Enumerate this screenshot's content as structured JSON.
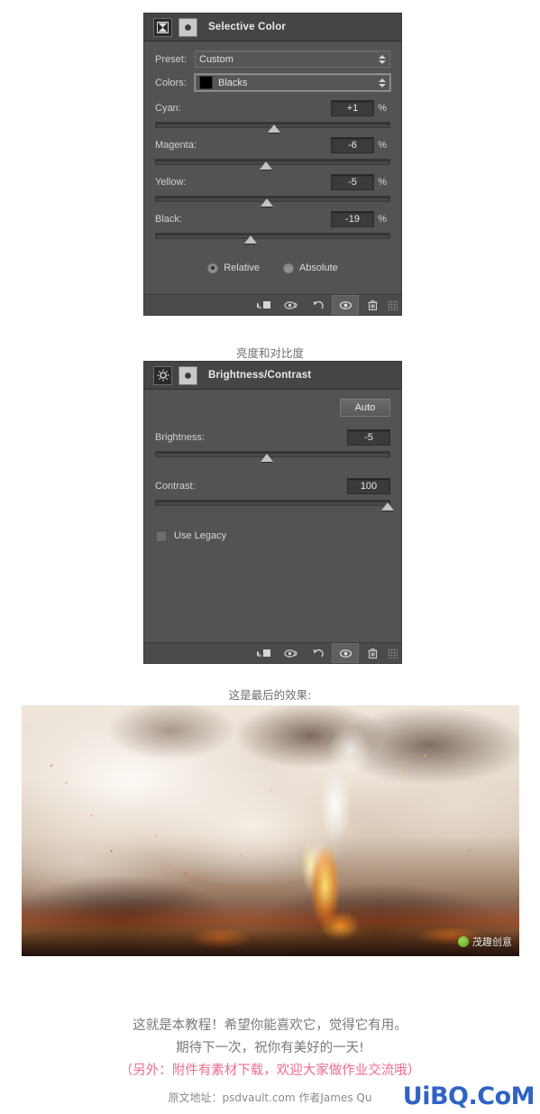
{
  "selective_color": {
    "title": "Selective Color",
    "icon": "selective-color-icon",
    "preset_label": "Preset:",
    "preset_value": "Custom",
    "colors_label": "Colors:",
    "colors_value": "Blacks",
    "colors_swatch": "#000000",
    "sliders": [
      {
        "label": "Cyan:",
        "value": "+1",
        "unit": "%",
        "pos": 50.5
      },
      {
        "label": "Magenta:",
        "value": "-6",
        "unit": "%",
        "pos": 47.0
      },
      {
        "label": "Yellow:",
        "value": "-5",
        "unit": "%",
        "pos": 47.5
      },
      {
        "label": "Black:",
        "value": "-19",
        "unit": "%",
        "pos": 40.5
      }
    ],
    "method": {
      "relative": "Relative",
      "absolute": "Absolute",
      "selected": "Relative"
    },
    "footer_icons": [
      "clip-to-layer-icon",
      "view-previous-state-icon",
      "reset-icon",
      "toggle-visibility-icon",
      "delete-layer-icon"
    ]
  },
  "bc_caption": "亮度和对比度",
  "brightness_contrast": {
    "title": "Brightness/Contrast",
    "icon": "brightness-contrast-icon",
    "auto_label": "Auto",
    "sliders": [
      {
        "label": "Brightness:",
        "value": "-5",
        "pos": 47.5
      },
      {
        "label": "Contrast:",
        "value": "100",
        "pos": 99.0
      }
    ],
    "use_legacy_label": "Use Legacy",
    "use_legacy_checked": false,
    "footer_icons": [
      "clip-to-layer-icon",
      "view-previous-state-icon",
      "reset-icon",
      "toggle-visibility-icon",
      "delete-layer-icon"
    ]
  },
  "result_caption": "这是最后的效果:",
  "artwork": {
    "alt": "fiery apocalyptic scene with smoke and a figure",
    "watermark_text": "茂趣创意"
  },
  "outro": {
    "line1": "这就是本教程！希望你能喜欢它，觉得它有用。",
    "line2": "期待下一次，祝你有美好的一天!",
    "line3": "（另外：附件有素材下载，欢迎大家做作业交流哦）",
    "credit": "原文地址：psdvault.com 作者James Qu"
  },
  "site_watermark": "UiBQ.CoM",
  "colors": {
    "panel_bg": "#535353",
    "titlebar_bg": "#454545",
    "footer_bg": "#4b4b4b",
    "caption_text": "#6f6f6f",
    "pink": "#ef6b8e",
    "watermark_blue": "#2f63c4"
  }
}
